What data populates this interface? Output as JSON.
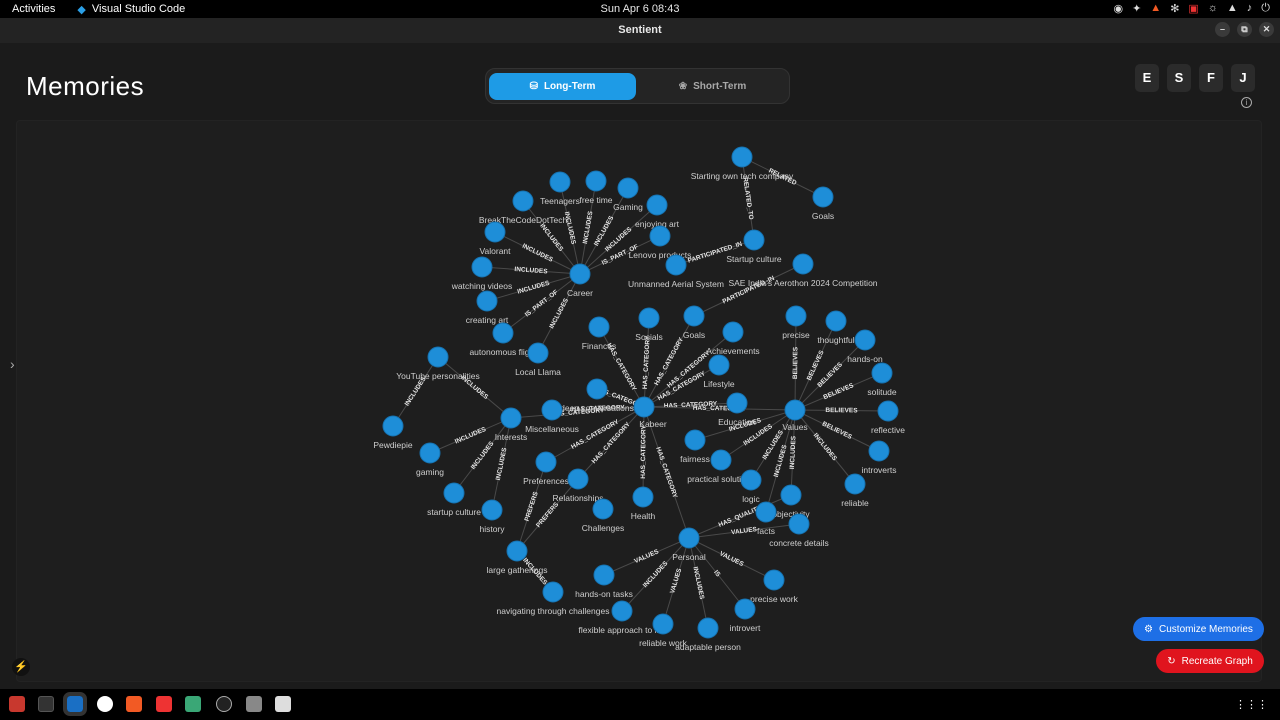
{
  "topbar": {
    "activities": "Activities",
    "app": "Visual Studio Code",
    "clock": "Sun Apr 6  08:43"
  },
  "window": {
    "title": "Sentient"
  },
  "page": {
    "title": "Memories"
  },
  "toggle": {
    "long_term": "Long-Term",
    "short_term": "Short-Term"
  },
  "letters": [
    "E",
    "S",
    "F",
    "J"
  ],
  "buttons": {
    "customize": "Customize Memories",
    "recreate": "Recreate Graph"
  },
  "colors": {
    "accent": "#1e9be6",
    "node": "#1e8ed8",
    "danger": "#e0141e",
    "customize": "#1e6fe6"
  },
  "graph": {
    "nodes": [
      {
        "id": "starting",
        "label": "Starting own tech company"
      },
      {
        "id": "goals1",
        "label": "Goals"
      },
      {
        "id": "teenagers",
        "label": "Teenagers"
      },
      {
        "id": "freetime",
        "label": "free time"
      },
      {
        "id": "gaming1",
        "label": "Gaming"
      },
      {
        "id": "btcdt",
        "label": "BreakTheCodeDotTech"
      },
      {
        "id": "enjoyingart",
        "label": "enjoying art"
      },
      {
        "id": "valorant",
        "label": "Valorant"
      },
      {
        "id": "lenovo",
        "label": "Lenovo products"
      },
      {
        "id": "startupculture1",
        "label": "Startup culture"
      },
      {
        "id": "sae",
        "label": "SAE India's Aerothon 2024 Competition"
      },
      {
        "id": "watching",
        "label": "watching videos"
      },
      {
        "id": "career",
        "label": "Career"
      },
      {
        "id": "uas",
        "label": "Unmanned Aerial System"
      },
      {
        "id": "creatingart",
        "label": "creating art"
      },
      {
        "id": "autonomous",
        "label": "autonomous flight"
      },
      {
        "id": "finances",
        "label": "Finances"
      },
      {
        "id": "socials",
        "label": "Socials"
      },
      {
        "id": "goals2",
        "label": "Goals"
      },
      {
        "id": "achievements",
        "label": "Achievements"
      },
      {
        "id": "precise",
        "label": "precise"
      },
      {
        "id": "thoughtful",
        "label": "thoughtful"
      },
      {
        "id": "handson",
        "label": "hands-on"
      },
      {
        "id": "localllama",
        "label": "Local Llama"
      },
      {
        "id": "youtube",
        "label": "YouTube personalities"
      },
      {
        "id": "lifestyle",
        "label": "Lifestyle"
      },
      {
        "id": "solitude",
        "label": "solitude"
      },
      {
        "id": "deepconv",
        "label": "deep conversations"
      },
      {
        "id": "kabeer",
        "label": "Kabeer"
      },
      {
        "id": "education",
        "label": "Education"
      },
      {
        "id": "values",
        "label": "Values"
      },
      {
        "id": "reflective",
        "label": "reflective"
      },
      {
        "id": "misc",
        "label": "Miscellaneous"
      },
      {
        "id": "interests",
        "label": "Interests"
      },
      {
        "id": "pewdiepie",
        "label": "Pewdiepie"
      },
      {
        "id": "fairness",
        "label": "fairness"
      },
      {
        "id": "introverts",
        "label": "introverts"
      },
      {
        "id": "gaming2",
        "label": "gaming"
      },
      {
        "id": "preferences",
        "label": "Preferences"
      },
      {
        "id": "practical",
        "label": "practical solutions"
      },
      {
        "id": "logic",
        "label": "logic"
      },
      {
        "id": "relationships",
        "label": "Relationships"
      },
      {
        "id": "reliable",
        "label": "reliable"
      },
      {
        "id": "objectivity",
        "label": "objectivity"
      },
      {
        "id": "startupculture2",
        "label": "startup culture"
      },
      {
        "id": "health",
        "label": "Health"
      },
      {
        "id": "facts",
        "label": "facts"
      },
      {
        "id": "history",
        "label": "history"
      },
      {
        "id": "challenges",
        "label": "Challenges"
      },
      {
        "id": "concrete",
        "label": "concrete details"
      },
      {
        "id": "personal",
        "label": "Personal"
      },
      {
        "id": "largegatherings",
        "label": "large gatherings"
      },
      {
        "id": "handsontasks",
        "label": "hands-on tasks"
      },
      {
        "id": "precisework",
        "label": "precise work"
      },
      {
        "id": "navigating",
        "label": "navigating through challenges"
      },
      {
        "id": "flexible",
        "label": "flexible approach to life"
      },
      {
        "id": "introvert",
        "label": "introvert"
      },
      {
        "id": "reliablework",
        "label": "reliable work"
      },
      {
        "id": "adaptable",
        "label": "adaptable person"
      }
    ],
    "edges": [
      {
        "from": "starting",
        "to": "goals1",
        "label": "RELATED"
      },
      {
        "from": "starting",
        "to": "startupculture1",
        "label": "RELATED_TO"
      },
      {
        "from": "startupculture1",
        "to": "uas",
        "label": "PARTICIPATED_IN"
      },
      {
        "from": "sae",
        "to": "goals2",
        "label": "PARTICIPATED_IN"
      },
      {
        "from": "career",
        "to": "teenagers",
        "label": "INCLUDES"
      },
      {
        "from": "career",
        "to": "freetime",
        "label": "INCLUDES"
      },
      {
        "from": "career",
        "to": "gaming1",
        "label": "INCLUDES"
      },
      {
        "from": "career",
        "to": "btcdt",
        "label": "INCLUDES"
      },
      {
        "from": "career",
        "to": "enjoyingart",
        "label": "INCLUDES"
      },
      {
        "from": "career",
        "to": "valorant",
        "label": "INCLUDES"
      },
      {
        "from": "career",
        "to": "lenovo",
        "label": "IS_PART_OF"
      },
      {
        "from": "career",
        "to": "watching",
        "label": "INCLUDES"
      },
      {
        "from": "career",
        "to": "creatingart",
        "label": "INCLUDES"
      },
      {
        "from": "career",
        "to": "autonomous",
        "label": "IS_PART_OF"
      },
      {
        "from": "career",
        "to": "localllama",
        "label": "INCLUDES"
      },
      {
        "from": "kabeer",
        "to": "finances",
        "label": "HAS_CATEGORY"
      },
      {
        "from": "kabeer",
        "to": "socials",
        "label": "HAS_CATEGORY"
      },
      {
        "from": "kabeer",
        "to": "goals2",
        "label": "HAS_CATEGORY"
      },
      {
        "from": "kabeer",
        "to": "achievements",
        "label": "HAS_CATEGORY"
      },
      {
        "from": "kabeer",
        "to": "lifestyle",
        "label": "HAS_CATEGORY"
      },
      {
        "from": "kabeer",
        "to": "education",
        "label": "HAS_CATEGORY"
      },
      {
        "from": "kabeer",
        "to": "values",
        "label": "HAS_CATEGORY"
      },
      {
        "from": "kabeer",
        "to": "deepconv",
        "label": "HAS_CATEGORY"
      },
      {
        "from": "kabeer",
        "to": "misc",
        "label": "HAS_CATEGORY"
      },
      {
        "from": "kabeer",
        "to": "interests",
        "label": "HAS_CATEGORY"
      },
      {
        "from": "kabeer",
        "to": "preferences",
        "label": "HAS_CATEGORY"
      },
      {
        "from": "kabeer",
        "to": "relationships",
        "label": "HAS_CATEGORY"
      },
      {
        "from": "kabeer",
        "to": "health",
        "label": "HAS_CATEGORY"
      },
      {
        "from": "kabeer",
        "to": "personal",
        "label": "HAS_CATEGORY"
      },
      {
        "from": "values",
        "to": "precise",
        "label": "BELIEVES"
      },
      {
        "from": "values",
        "to": "thoughtful",
        "label": "BELIEVES"
      },
      {
        "from": "values",
        "to": "handson",
        "label": "BELIEVES"
      },
      {
        "from": "values",
        "to": "solitude",
        "label": "BELIEVES"
      },
      {
        "from": "values",
        "to": "reflective",
        "label": "BELIEVES"
      },
      {
        "from": "values",
        "to": "introverts",
        "label": "BELIEVES"
      },
      {
        "from": "values",
        "to": "reliable",
        "label": "INCLUDES"
      },
      {
        "from": "values",
        "to": "fairness",
        "label": "INCLUDES"
      },
      {
        "from": "values",
        "to": "practical",
        "label": "INCLUDES"
      },
      {
        "from": "values",
        "to": "logic",
        "label": "INCLUDES"
      },
      {
        "from": "values",
        "to": "objectivity",
        "label": "INCLUDES"
      },
      {
        "from": "values",
        "to": "facts",
        "label": "INCLUDES"
      },
      {
        "from": "interests",
        "to": "youtube",
        "label": "INCLUDES"
      },
      {
        "from": "youtube",
        "to": "pewdiepie",
        "label": "INCLUDES"
      },
      {
        "from": "interests",
        "to": "gaming2",
        "label": "INCLUDES"
      },
      {
        "from": "interests",
        "to": "startupculture2",
        "label": "INCLUDES"
      },
      {
        "from": "interests",
        "to": "history",
        "label": "INCLUDES"
      },
      {
        "from": "preferences",
        "to": "largegatherings",
        "label": "PREFERS"
      },
      {
        "from": "relationships",
        "to": "largegatherings",
        "label": "PREFERS"
      },
      {
        "from": "largegatherings",
        "to": "navigating",
        "label": "INCLUDES"
      },
      {
        "from": "personal",
        "to": "handsontasks",
        "label": "VALUES"
      },
      {
        "from": "personal",
        "to": "flexible",
        "label": "INCLUDES"
      },
      {
        "from": "personal",
        "to": "reliablework",
        "label": "VALUES"
      },
      {
        "from": "personal",
        "to": "adaptable",
        "label": "INCLUDES"
      },
      {
        "from": "personal",
        "to": "introvert",
        "label": "IS"
      },
      {
        "from": "personal",
        "to": "precisework",
        "label": "VALUES"
      },
      {
        "from": "personal",
        "to": "objectivity",
        "label": "HAS_QUALITY"
      },
      {
        "from": "personal",
        "to": "concrete",
        "label": "VALUES"
      }
    ]
  }
}
